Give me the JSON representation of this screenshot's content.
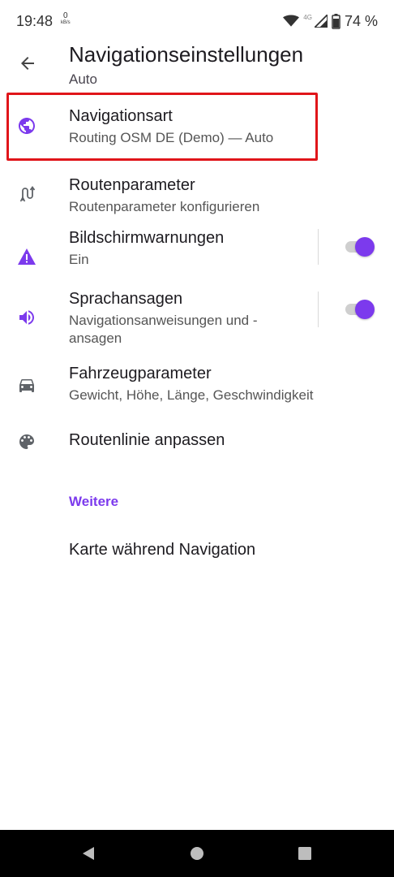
{
  "status_bar": {
    "time": "19:48",
    "net_speed_value": "0",
    "net_speed_unit": "kB/s",
    "network_label": "4G",
    "battery": "74 %"
  },
  "header": {
    "title": "Navigationseinstellungen",
    "subtitle": "Auto"
  },
  "items": [
    {
      "title": "Navigationsart",
      "subtitle": "Routing OSM DE (Demo) — Auto",
      "icon": "globe-icon",
      "highlighted": true
    },
    {
      "title": "Routenparameter",
      "subtitle": "Routenparameter konfigurieren",
      "icon": "route-icon"
    },
    {
      "title": "Bildschirmwarnungen",
      "subtitle": "Ein",
      "icon": "warning-icon",
      "toggle": true
    },
    {
      "title": "Sprachansagen",
      "subtitle": "Navigationsanweisungen und -ansagen",
      "icon": "speaker-icon",
      "toggle": true
    },
    {
      "title": "Fahrzeugparameter",
      "subtitle": "Gewicht, Höhe, Länge, Geschwindigkeit",
      "icon": "car-icon"
    },
    {
      "title": "Routenlinie anpassen",
      "icon": "palette-icon"
    }
  ],
  "section": {
    "header": "Weitere",
    "items": [
      {
        "title": "Karte während Navigation"
      }
    ]
  },
  "colors": {
    "accent": "#7c3aed",
    "highlight_border": "#e0151a",
    "icon_gray": "#5f6368"
  }
}
